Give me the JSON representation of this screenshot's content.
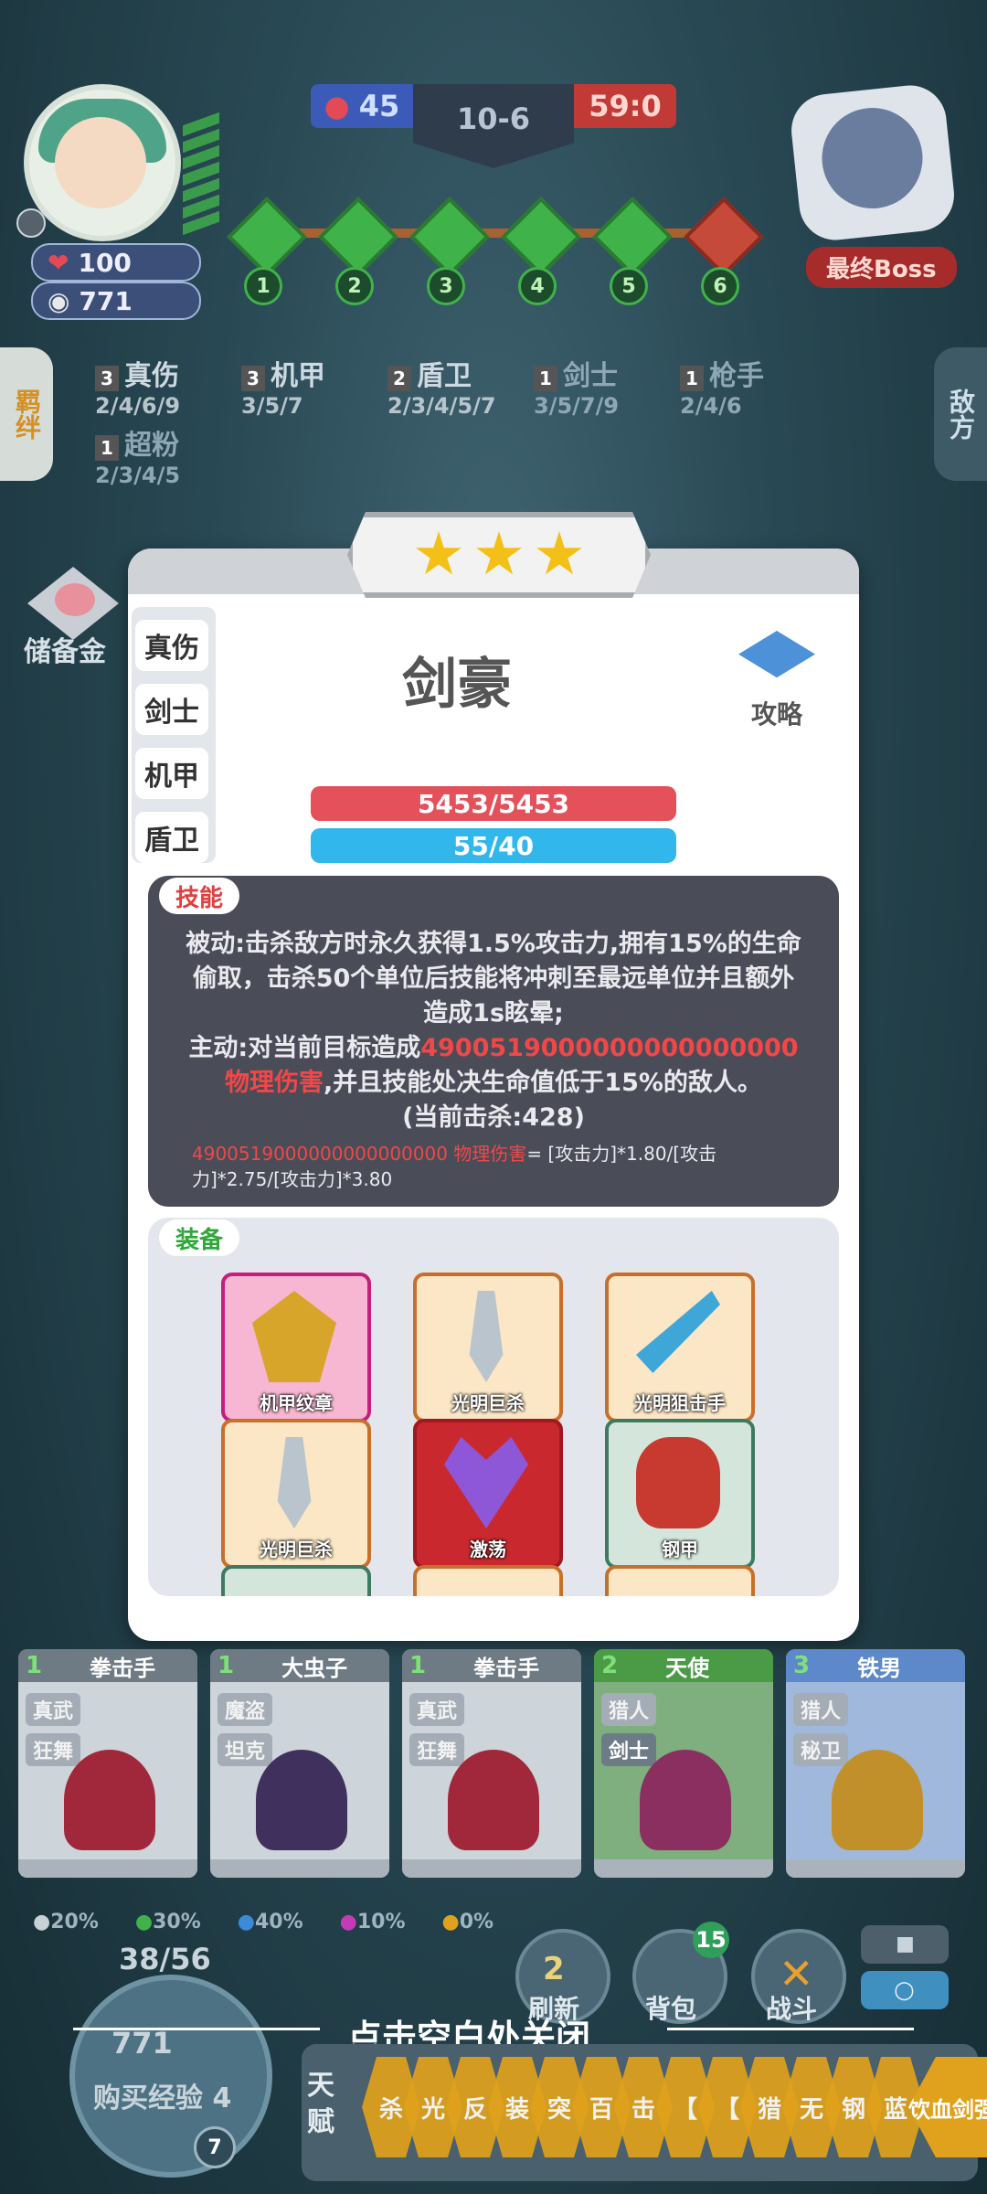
{
  "player": {
    "hp": "100",
    "gold": "771"
  },
  "score": {
    "left": "45",
    "stage": "10-6",
    "right": "59:0"
  },
  "stages": [
    "1",
    "2",
    "3",
    "4",
    "5",
    "6"
  ],
  "boss_label": "最终Boss",
  "side_tabs": {
    "left": "羁绊",
    "right": "敌方"
  },
  "synergies": [
    {
      "count": "3",
      "name": "真伤",
      "levels": "2/4/6/9"
    },
    {
      "count": "3",
      "name": "机甲",
      "levels": "3/5/7"
    },
    {
      "count": "2",
      "name": "盾卫",
      "levels": "2/3/4/5/7"
    },
    {
      "count": "1",
      "name": "剑士",
      "levels": "3/5/7/9"
    },
    {
      "count": "1",
      "name": "枪手",
      "levels": "2/4/6"
    },
    {
      "count": "1",
      "name": "超粉",
      "levels": "2/3/4/5"
    }
  ],
  "savings_label": "储备金",
  "hero": {
    "name": "剑豪",
    "stars": 3,
    "traits": [
      "真伤",
      "剑士",
      "机甲",
      "盾卫"
    ],
    "guide_label": "攻略",
    "hp": "5453/5453",
    "mana": "55/40"
  },
  "skill": {
    "tag": "技能",
    "line1": "被动:击杀敌方时永久获得1.5%攻击力,拥有15%的生命偷取，击杀50个单位后技能将冲刺至最远单位并且额外造成1s眩晕;",
    "active_prefix": "主动:对当前目标造成",
    "active_damage": "4900519000000000000000 物理伤害",
    "active_suffix": ",并且技能处决生命值低于15%的敌人。",
    "kills": "(当前击杀:428)",
    "formula_damage": "4900519000000000000000 物理伤害",
    "formula_rest": "= [攻击力]*1.80/[攻击力]*2.75/[攻击力]*3.80"
  },
  "equipment": {
    "tag": "装备",
    "items": [
      "机甲纹章",
      "光明巨杀",
      "光明狙击手",
      "光明巨杀",
      "激荡",
      "钢甲"
    ]
  },
  "bench": [
    {
      "count": "1",
      "name": "拳击手",
      "traits": [
        "真武",
        "狂舞"
      ]
    },
    {
      "count": "1",
      "name": "大虫子",
      "traits": [
        "魔盗",
        "坦克"
      ]
    },
    {
      "count": "1",
      "name": "拳击手",
      "traits": [
        "真武",
        "狂舞"
      ]
    },
    {
      "count": "2",
      "name": "天使",
      "traits": [
        "猎人",
        "剑士"
      ]
    },
    {
      "count": "3",
      "name": "铁男",
      "traits": [
        "猎人",
        "秘卫"
      ]
    }
  ],
  "odds": [
    "20%",
    "30%",
    "40%",
    "10%",
    "0%"
  ],
  "exp": {
    "progress": "38/56",
    "gold": "771",
    "label": "购买经验",
    "cost": "4",
    "level": "7"
  },
  "buttons": {
    "refresh": "刷新",
    "refresh_cost": "2",
    "bag": "背包",
    "bag_count": "15",
    "battle": "战斗"
  },
  "close_hint": "点击空白处关闭",
  "talent": {
    "label": "天赋",
    "chips": [
      "杀",
      "光",
      "反",
      "装",
      "突",
      "百",
      "击",
      "【",
      "【",
      "猎",
      "无",
      "钢",
      "蓝",
      "饮血剑强化"
    ]
  },
  "colors": {
    "hp": "#e4515b",
    "mana": "#32b7ec",
    "red_text": "#f04848",
    "star": "#f3c018"
  }
}
